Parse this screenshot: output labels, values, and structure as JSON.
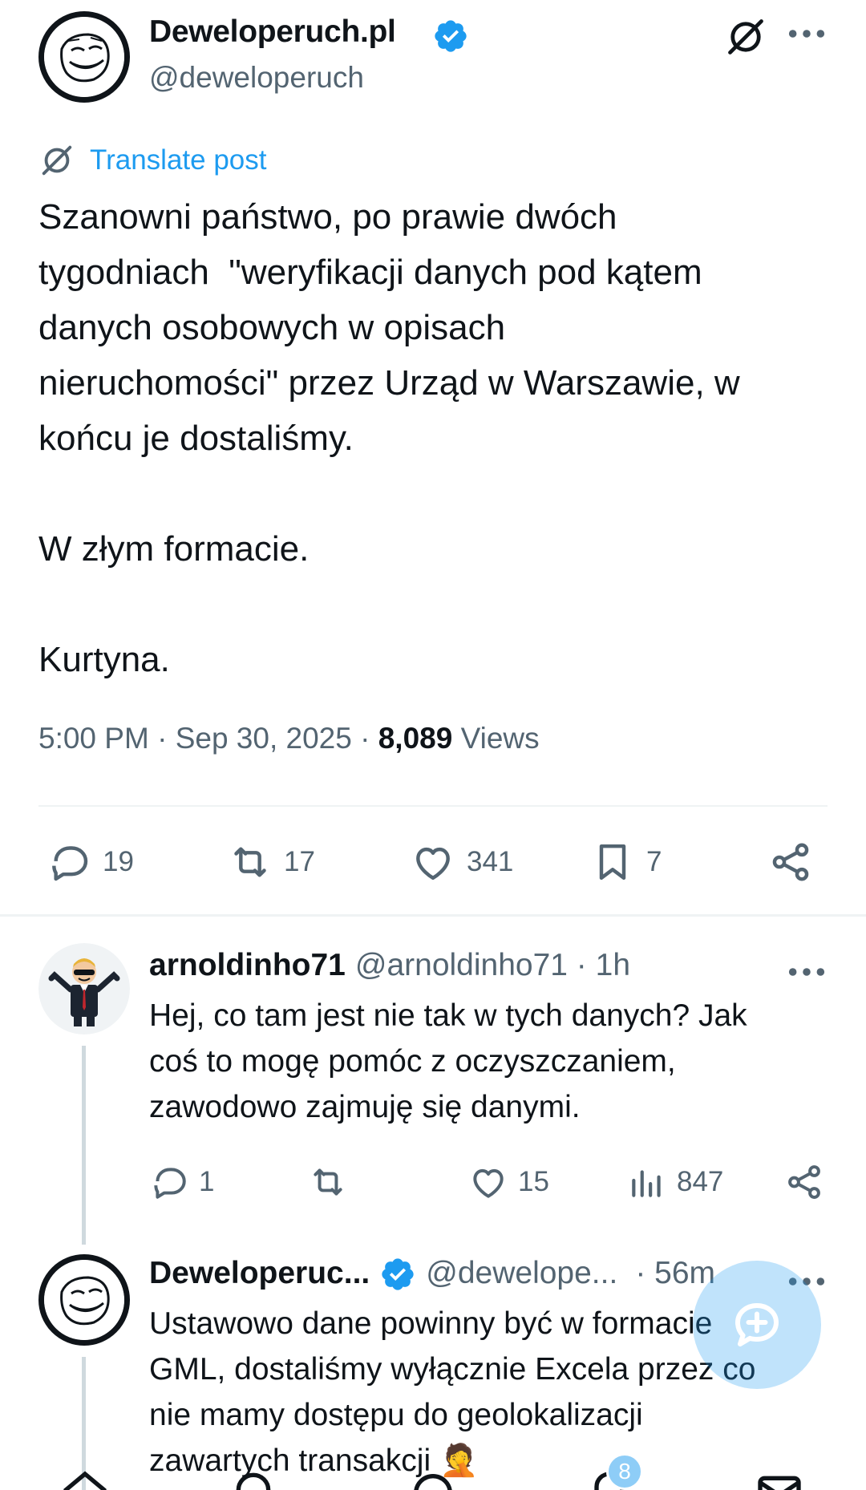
{
  "post": {
    "display_name": "Deweloperuch.pl",
    "handle": "@deweloperuch",
    "translate_label": "Translate post",
    "text": "Szanowni państwo, po prawie dwóch\ntygodniach  \"weryfikacji danych pod kątem\ndanych osobowych w opisach\nnieruchomości\" przez Urząd w Warszawie, w\nkońcu je dostaliśmy.\n\nW złym formacie.\n\nKurtyna.",
    "time": "5:00 PM",
    "date": "Sep 30, 2025",
    "separator": " · ",
    "views_count": "8,089",
    "views_label": "Views",
    "replies": "19",
    "reposts": "17",
    "likes": "341",
    "bookmarks": "7"
  },
  "replies": [
    {
      "display_name": "arnoldinho71",
      "handle": "@arnoldinho71 · 1h",
      "text": "Hej, co tam jest nie tak w tych danych? Jak\ncoś to mogę pomóc z oczyszczaniem,\nzawodowo zajmuję się danymi.",
      "replies": "1",
      "reposts": "",
      "likes": "15",
      "views": "847"
    },
    {
      "display_name": "Deweloperuc...",
      "handle": "@dewelope...",
      "time": "· 56m",
      "text": "Ustawowo dane powinny być w formacie\nGML, dostaliśmy wyłącznie Excela przez co\nnie mamy dostępu do geolokalizacji\nzawartych transakcji 🤦"
    }
  ],
  "nav": {
    "notifications_badge": "8"
  },
  "colors": {
    "accent": "#1d9bf0",
    "secondary_text": "#536471",
    "primary_text": "#0f1419"
  },
  "icons": [
    "verified-badge-icon",
    "grok-icon",
    "more-icon",
    "translate-icon",
    "reply-icon",
    "repost-icon",
    "like-icon",
    "bookmark-icon",
    "share-icon",
    "views-icon",
    "compose-icon",
    "home-icon",
    "search-icon",
    "notifications-icon",
    "messages-icon"
  ]
}
